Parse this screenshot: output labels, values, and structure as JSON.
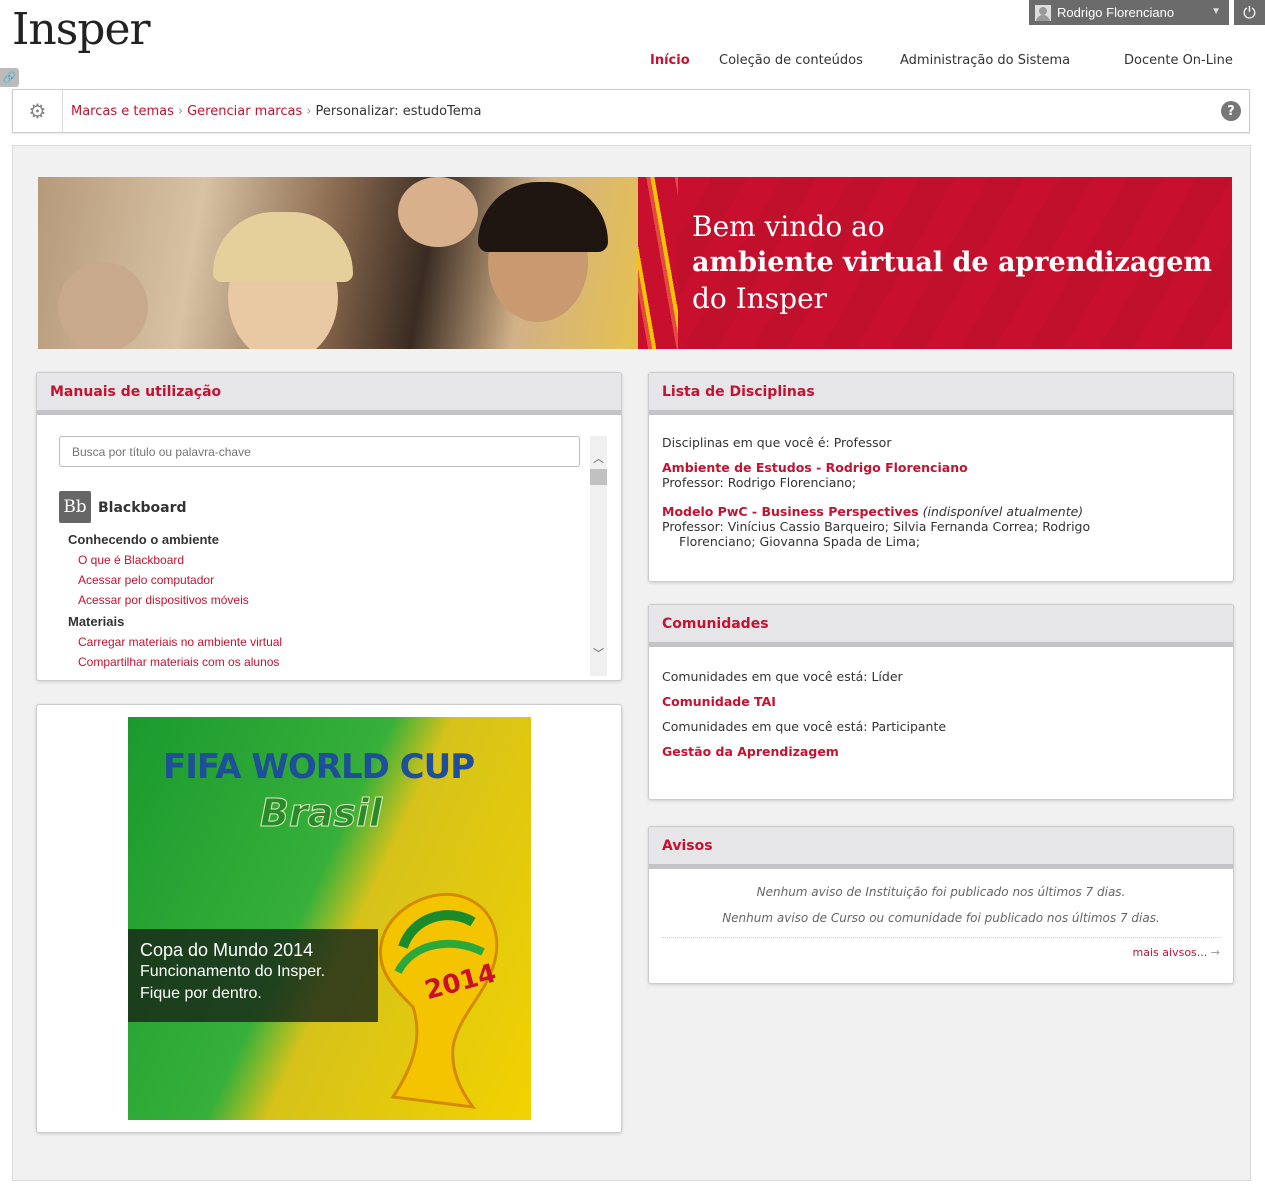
{
  "header": {
    "logo_text": "Insper",
    "user_name": "Rodrigo Florenciano",
    "nav": [
      "Início",
      "Coleção de conteúdos",
      "Administração do Sistema",
      "Docente On-Line"
    ]
  },
  "breadcrumb": {
    "items": [
      "Marcas e temas",
      "Gerenciar marcas"
    ],
    "current": "Personalizar: estudoTema"
  },
  "banner": {
    "line1": "Bem vindo ao",
    "line2": "ambiente virtual de aprendizagem",
    "line3": "do Insper"
  },
  "manuais": {
    "title": "Manuais de utilização",
    "search_placeholder": "Busca por título ou palavra-chave",
    "brand_logo": "Bb",
    "brand": "Blackboard",
    "sections": [
      {
        "title": "Conhecendo o ambiente",
        "links": [
          "O que é Blackboard",
          "Acessar pelo computador",
          "Acessar por dispositivos móveis"
        ]
      },
      {
        "title": "Materiais",
        "links": [
          "Carregar materiais no ambiente virtual",
          "Compartilhar materiais com os alunos"
        ]
      }
    ]
  },
  "worldcup": {
    "title": "FIFA WORLD CUP",
    "subtitle": "Brasil",
    "year": "2014",
    "caption1": "Copa do Mundo 2014",
    "caption2": "Funcionamento do Insper.",
    "caption3": "Fique por dentro."
  },
  "disciplinas": {
    "title": "Lista de Disciplinas",
    "intro": "Disciplinas em que você é: Professor",
    "course1": "Ambiente de Estudos - Rodrigo Florenciano",
    "course1_prof": "Professor: Rodrigo Florenciano;",
    "course2": "Modelo PwC - Business Perspectives",
    "course2_status": "(indisponível atualmente)",
    "course2_prof": "Professor: Vinícius Cassio Barqueiro; Silvia Fernanda Correa; Rodrigo Florenciano; Giovanna Spada de Lima;"
  },
  "comunidades": {
    "title": "Comunidades",
    "leader_intro": "Comunidades em que você está: Líder",
    "leader_item": "Comunidade TAI",
    "part_intro": "Comunidades em que você está: Participante",
    "part_item": "Gestão da Aprendizagem"
  },
  "avisos": {
    "title": "Avisos",
    "notice1": "Nenhum aviso de Instituição foi publicado nos últimos 7 dias.",
    "notice2": "Nenhum aviso de Curso ou comunidade foi publicado nos últimos 7 dias.",
    "more": "mais aivsos..."
  },
  "colors": {
    "brand_red": "#c41230",
    "banner_red": "#c8102e",
    "header_gray": "#6b6b6b"
  }
}
